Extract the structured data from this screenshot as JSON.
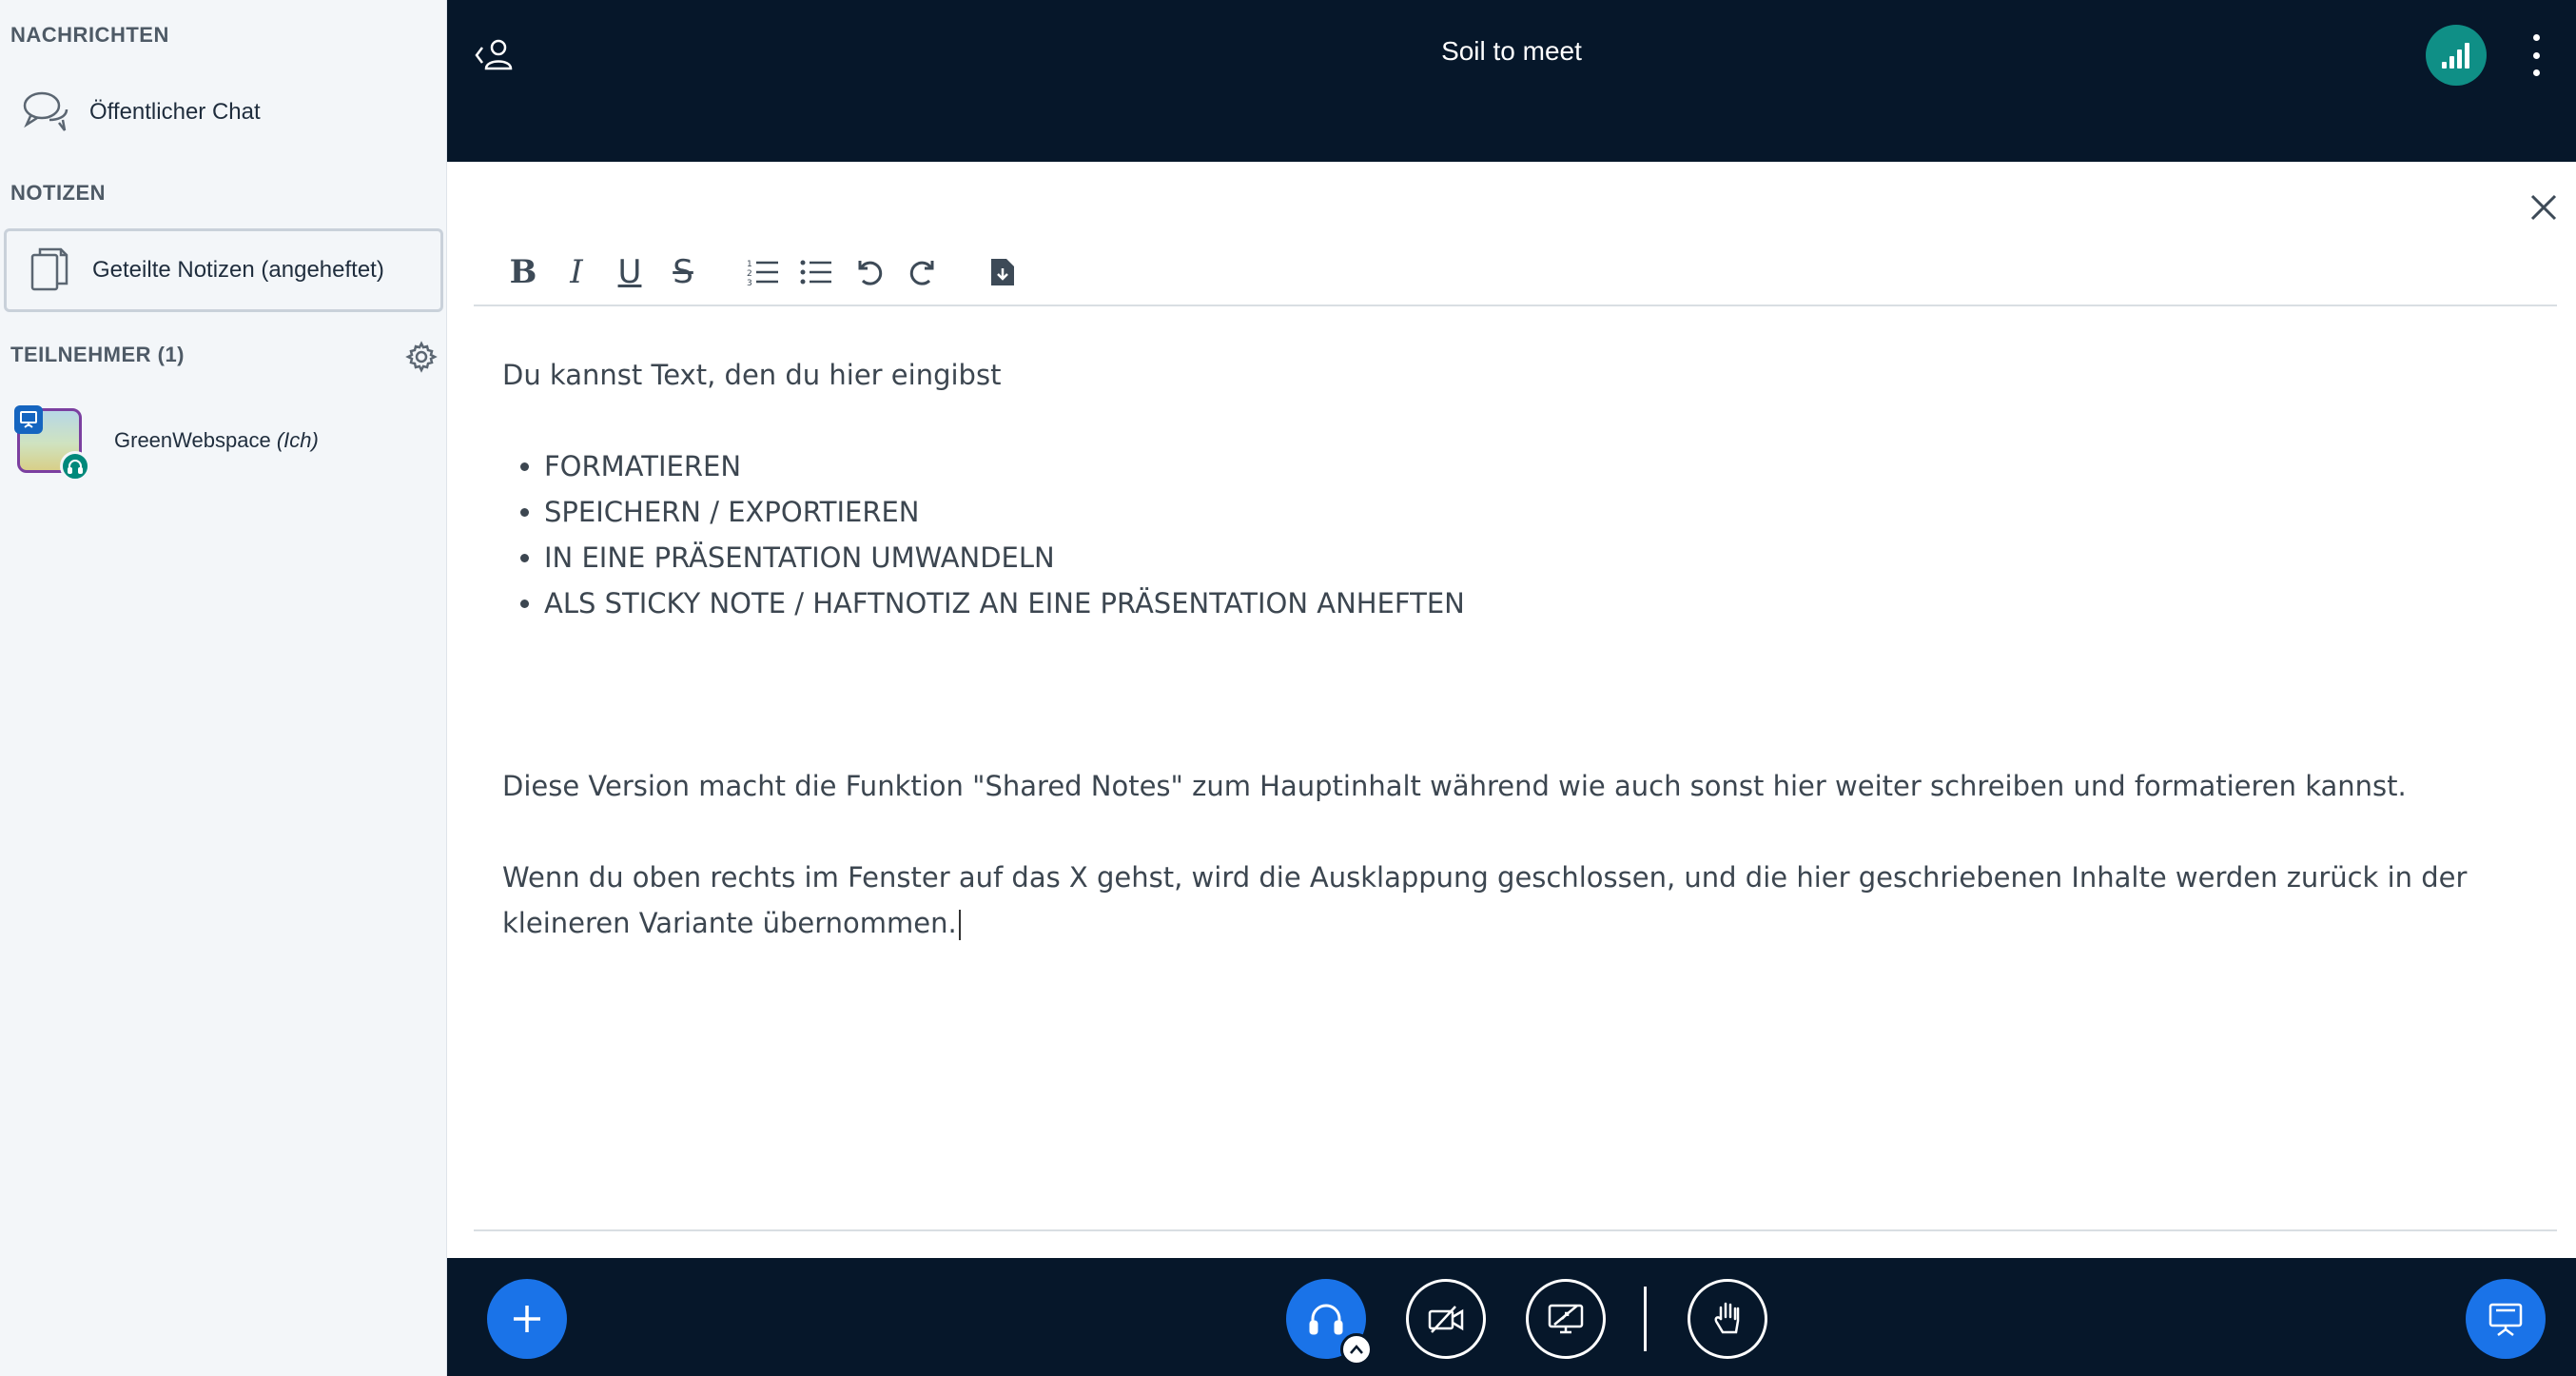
{
  "sidebar": {
    "messages_title": "NACHRICHTEN",
    "public_chat": "Öffentlicher Chat",
    "notes_title": "NOTIZEN",
    "shared_notes": "Geteilte Notizen (angeheftet)",
    "participants_title": "TEILNEHMER (1)",
    "user": {
      "name": "GreenWebspace",
      "self_tag": "(Ich)"
    }
  },
  "header": {
    "title": "Soil to meet"
  },
  "notes": {
    "intro": "Du kannst Text, den du hier eingibst",
    "bullets": [
      "FORMATIEREN",
      "SPEICHERN / EXPORTIEREN",
      "IN EINE PRÄSENTATION UMWANDELN",
      "ALS STICKY NOTE / HAFTNOTIZ AN EINE PRÄSENTATION ANHEFTEN"
    ],
    "paragraph1": "Diese Version macht die Funktion \"Shared Notes\" zum Hauptinhalt während wie auch sonst hier weiter schreiben und formatieren kannst.",
    "paragraph2": "Wenn du oben rechts im Fenster auf das X gehst, wird die Ausklappung geschlossen, und die hier geschriebenen Inhalte werden zurück in der kleineren Variante übernommen."
  },
  "toolbar": {
    "bold": "B",
    "italic": "I",
    "underline": "U",
    "strike": "S"
  },
  "colors": {
    "topbar": "#06172a",
    "accent": "#1a73e8",
    "connection": "#0f8f86"
  }
}
